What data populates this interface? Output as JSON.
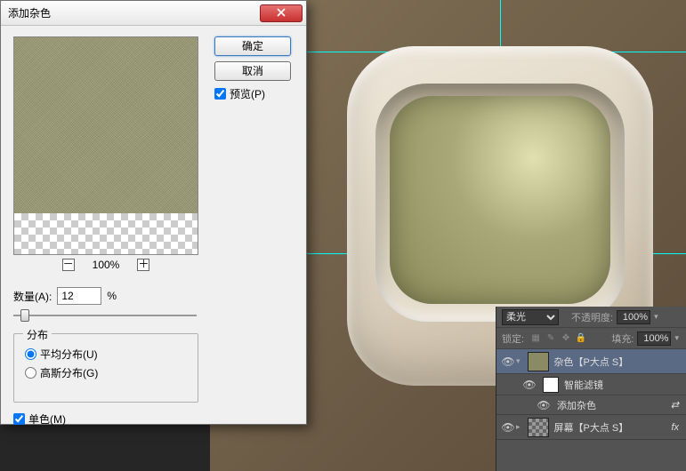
{
  "dialog": {
    "title": "添加杂色",
    "ok": "确定",
    "cancel": "取消",
    "preview_label": "预览(P)",
    "zoom": "100%",
    "amount_label": "数量(A):",
    "amount_value": "12",
    "amount_unit": "%",
    "distribution_legend": "分布",
    "uniform": "平均分布(U)",
    "gaussian": "高斯分布(G)",
    "mono": "单色(M)"
  },
  "layers": {
    "blend_mode": "柔光",
    "opacity_label": "不透明度:",
    "opacity_value": "100%",
    "lock_label": "锁定:",
    "fill_label": "填充:",
    "fill_value": "100%",
    "items": [
      {
        "name": "杂色【P大点 S】"
      },
      {
        "name": "智能滤镜"
      },
      {
        "name": "添加杂色"
      },
      {
        "name": "屏幕【P大点 S】"
      }
    ]
  },
  "guides": {
    "h1": 58,
    "h2": 285,
    "v1": 562
  },
  "colors": {
    "guide": "#00ffff"
  }
}
